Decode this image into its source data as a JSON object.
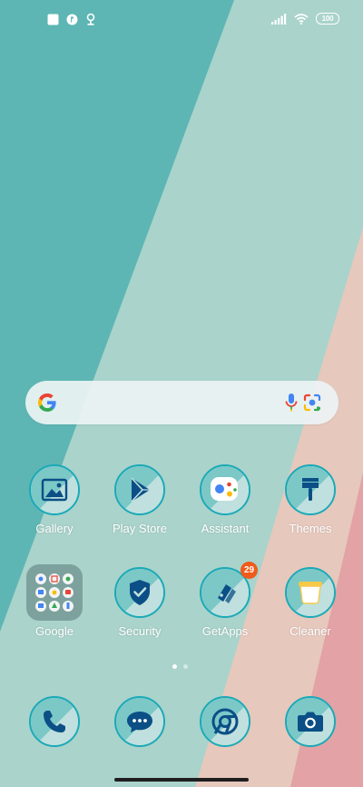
{
  "status_bar": {
    "left_icons": [
      "square-notification-icon",
      "app-notification-icon",
      "location-icon"
    ],
    "right_icons": [
      "signal-icon",
      "wifi-icon"
    ],
    "battery_level": "100"
  },
  "search_bar": {
    "logo": "google-g-icon",
    "mic": "mic-icon",
    "lens": "google-lens-icon"
  },
  "apps": [
    {
      "label": "Gallery",
      "icon": "gallery-icon"
    },
    {
      "label": "Play Store",
      "icon": "play-store-icon"
    },
    {
      "label": "Assistant",
      "icon": "assistant-icon"
    },
    {
      "label": "Themes",
      "icon": "themes-brush-icon"
    },
    {
      "label": "Google",
      "icon": "google-folder-icon"
    },
    {
      "label": "Security",
      "icon": "shield-check-icon"
    },
    {
      "label": "GetApps",
      "icon": "getapps-icon",
      "badge": "29"
    },
    {
      "label": "Cleaner",
      "icon": "cleaner-icon"
    }
  ],
  "dock": [
    {
      "name": "Phone",
      "icon": "phone-icon"
    },
    {
      "name": "Messages",
      "icon": "messages-icon"
    },
    {
      "name": "Chrome",
      "icon": "chrome-icon"
    },
    {
      "name": "Camera",
      "icon": "camera-icon"
    }
  ],
  "page_indicator": {
    "pages": 2,
    "current": 1
  },
  "colors": {
    "wallpaper_teal": "#5db6b4",
    "wallpaper_light": "#a9d3cb",
    "wallpaper_peach": "#e6c8bd",
    "wallpaper_pink": "#e3a2a5",
    "icon_ring": "#1aa9b7",
    "icon_glyph": "#0b4f86",
    "badge": "#ef5b1b"
  }
}
